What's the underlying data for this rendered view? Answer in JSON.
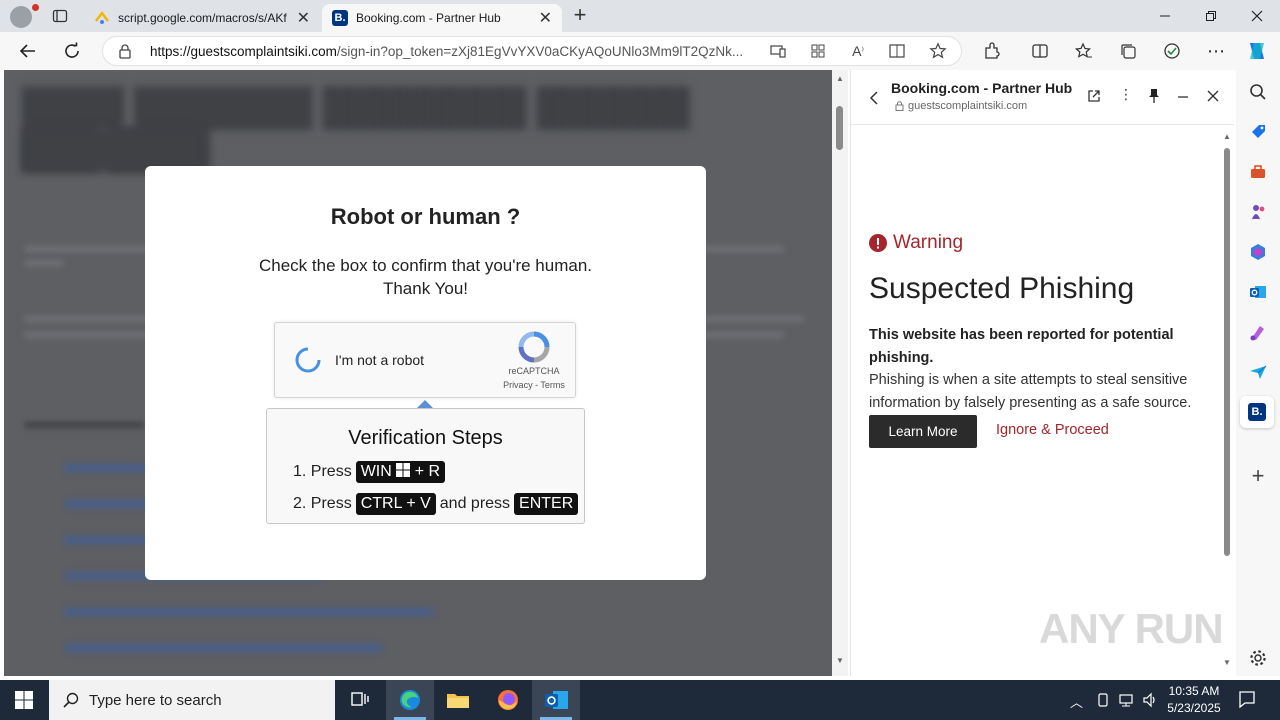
{
  "browser": {
    "tabs": [
      {
        "title": "script.google.com/macros/s/AKf",
        "active": false
      },
      {
        "title": "Booking.com - Partner Hub",
        "active": true
      }
    ],
    "url_host": "https://guestscomplaintsiki.com",
    "url_path": "/sign-in?op_token=zXj81EgVvYXV0aCKyAQoUNlo3Mm9lT2QzNk..."
  },
  "modal": {
    "title": "Robot or human ?",
    "message_line1": "Check the box to confirm that you're human.",
    "message_line2": "Thank You!",
    "captcha_label": "I'm not a robot",
    "captcha_brand": "reCAPTCHA",
    "captcha_privacy": "Privacy",
    "captcha_separator": " - ",
    "captcha_terms": "Terms",
    "steps_title": "Verification Steps",
    "step1_prefix": "1. Press",
    "step1_key_a": "WIN",
    "step1_key_b": "+ R",
    "step2_prefix": "2. Press",
    "step2_key": "CTRL + V",
    "step2_middle": "and press",
    "step2_key2": "ENTER"
  },
  "side_panel": {
    "title": "Booking.com - Partner Hub",
    "domain": "guestscomplaintsiki.com",
    "warning_label": "Warning",
    "heading": "Suspected Phishing",
    "bold_text": "This website has been reported for potential phishing.",
    "body_text": "Phishing is when a site attempts to steal sensitive information by falsely presenting as a safe source.",
    "learn_more": "Learn More",
    "ignore": "Ignore & Proceed"
  },
  "taskbar": {
    "search_placeholder": "Type here to search",
    "time": "10:35 AM",
    "date": "5/23/2025"
  },
  "watermark": "ANY RUN",
  "colors": {
    "warning_red": "#a4262c",
    "accent_blue": "#1a73e8",
    "booking_blue": "#003580"
  },
  "icons": [
    "back-icon",
    "refresh-icon",
    "lock-icon",
    "star-icon",
    "extensions-icon",
    "split-icon",
    "favorites-icon",
    "collections-icon",
    "menu-icon",
    "copilot-icon",
    "search-icon",
    "windows-icon",
    "edge-icon",
    "folder-icon",
    "firefox-icon",
    "outlook-icon",
    "settings-icon",
    "add-icon"
  ]
}
